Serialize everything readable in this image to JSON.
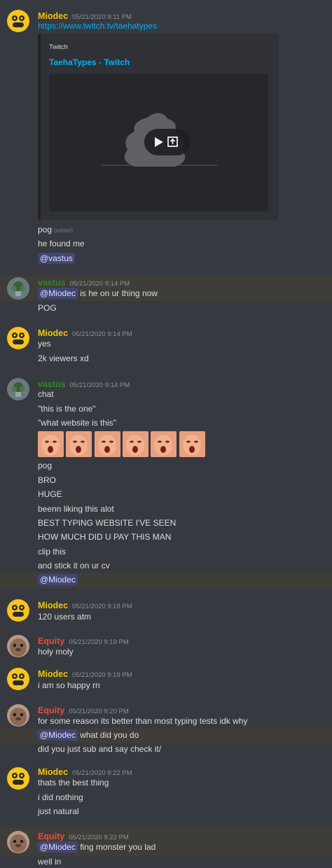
{
  "users": {
    "miodec": "Miodec",
    "vastus": "vastus",
    "equity": "Equity"
  },
  "colors": {
    "background": "#36393f",
    "highlight": "#3f3d38",
    "miodec": "#f1c40f",
    "vastus": "#2f8a25",
    "equity": "#e74c3c",
    "link": "#00b0f4",
    "mention": "#414675"
  },
  "icons": {
    "miodec_avatar": "monkey-face-icon",
    "vastus_avatar": "plant-icon",
    "equity_avatar": "seal-face-icon",
    "play": "play-icon",
    "open_external": "external-link-icon"
  },
  "msg1": {
    "time": "05/21/2020 9:11 PM",
    "link": "https://www.twitch.tv/taehatypes",
    "embed": {
      "provider": "Twitch",
      "title": "TaehaTypes - Twitch"
    },
    "line1": "pog",
    "edited": "(edited)",
    "line2": "he found me",
    "mention": "@vastus"
  },
  "msg2": {
    "time": "05/21/2020 9:14 PM",
    "mention": "@Miodec",
    "text": "is he on ur thing now",
    "line2": "POG"
  },
  "msg3": {
    "time": "05/21/2020 9:14 PM",
    "line1": "yes",
    "line2": "2k viewers xd"
  },
  "msg4": {
    "time": "05/21/2020 9:14 PM",
    "line1": "chat",
    "line2": "\"this is the one\"",
    "line3": "\"what website is this\"",
    "emote_count": 6,
    "line4": "pog",
    "line5": "BRO",
    "line6": "HUGE",
    "line7": "beenn liking this alot",
    "line8": "BEST TYPING WEBSITE I'VE SEEN",
    "line9": "HOW MUCH DID U PAY THIS MAN",
    "line10": "clip this",
    "line11": "and stick it on ur cv",
    "mention": "@Miodec"
  },
  "msg5": {
    "time": "05/21/2020 9:18 PM",
    "line1": "120 users atm"
  },
  "msg6": {
    "time": "05/21/2020 9:19 PM",
    "line1": "holy moly"
  },
  "msg7": {
    "time": "05/21/2020 9:19 PM",
    "line1": "i am so happy rn"
  },
  "msg8": {
    "time": "05/21/2020 9:20 PM",
    "line1": "for some reason its better than most typing tests idk why",
    "mention": "@Miodec",
    "text": "what did you do",
    "line3": "did you just sub and say check it/"
  },
  "msg9": {
    "time": "05/21/2020 9:22 PM",
    "line1": "thats the best thing",
    "line2": "i did nothing",
    "line3": "just natural"
  },
  "msg10": {
    "time": "05/21/2020 9:22 PM",
    "mention": "@Miodec",
    "text": "fing monster you lad",
    "line2": "well in"
  }
}
